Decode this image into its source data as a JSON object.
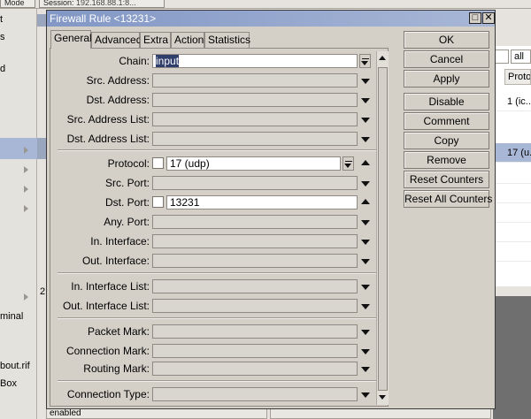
{
  "topbar": {
    "mode_label": "Mode",
    "session_label": "Session:",
    "session_value": "192.168.88.1:8..."
  },
  "left_menu": {
    "items": [
      "t",
      "s",
      "d",
      "minal",
      "bout.rif",
      "Box"
    ]
  },
  "bg": {
    "filter_value": "all",
    "column_header": "Proto...",
    "rows": [
      "1 (ic...",
      "17 (u..."
    ],
    "left_label": "2",
    "status_text": "enabled"
  },
  "dialog": {
    "title": "Firewall Rule <13231>",
    "tabs": [
      "General",
      "Advanced",
      "Extra",
      "Action",
      "Statistics"
    ],
    "fields": {
      "chain": {
        "label": "Chain:",
        "value": "input"
      },
      "src_address": {
        "label": "Src. Address:"
      },
      "dst_address": {
        "label": "Dst. Address:"
      },
      "src_address_list": {
        "label": "Src. Address List:"
      },
      "dst_address_list": {
        "label": "Dst. Address List:"
      },
      "protocol": {
        "label": "Protocol:",
        "value": "17 (udp)"
      },
      "src_port": {
        "label": "Src. Port:"
      },
      "dst_port": {
        "label": "Dst. Port:",
        "value": "13231"
      },
      "any_port": {
        "label": "Any. Port:"
      },
      "in_interface": {
        "label": "In. Interface:"
      },
      "out_interface": {
        "label": "Out. Interface:"
      },
      "in_interface_list": {
        "label": "In. Interface List:"
      },
      "out_interface_list": {
        "label": "Out. Interface List:"
      },
      "packet_mark": {
        "label": "Packet Mark:"
      },
      "connection_mark": {
        "label": "Connection Mark:"
      },
      "routing_mark": {
        "label": "Routing Mark:"
      },
      "connection_type": {
        "label": "Connection Type:"
      }
    },
    "buttons": {
      "ok": "OK",
      "cancel": "Cancel",
      "apply": "Apply",
      "disable": "Disable",
      "comment": "Comment",
      "copy": "Copy",
      "remove": "Remove",
      "reset_counters": "Reset Counters",
      "reset_all_counters": "Reset All Counters"
    },
    "title_buttons": {
      "maximize_glyph": "□",
      "close_glyph": "✕"
    }
  },
  "colors": {
    "titlebar": "#8297c5",
    "selection": "#a9b7d6",
    "highlight": "#2f3e6b"
  }
}
